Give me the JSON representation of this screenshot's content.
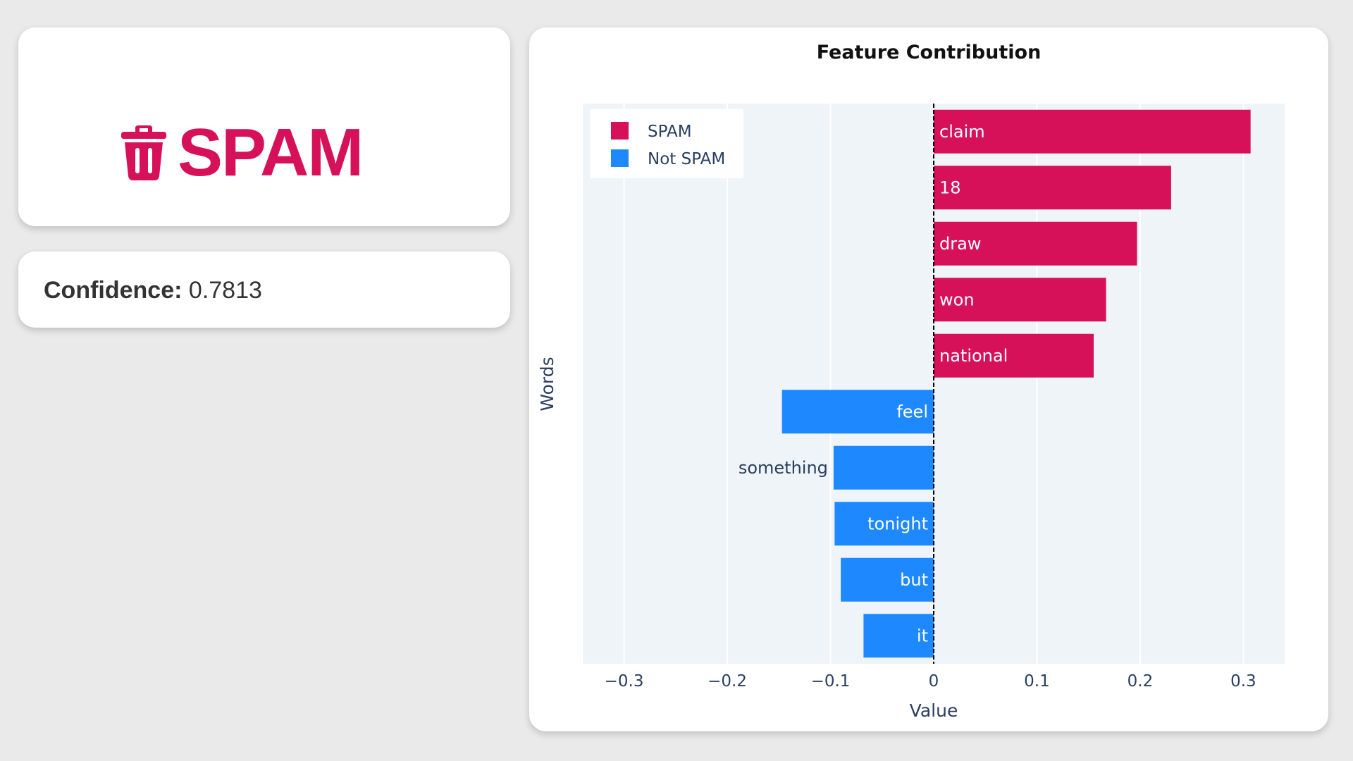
{
  "verdict": {
    "label": "SPAM",
    "icon": "trash-icon",
    "color": "#d6115a"
  },
  "confidence": {
    "label": "Confidence:",
    "value": "0.7813"
  },
  "chart_data": {
    "type": "bar",
    "orientation": "horizontal",
    "title": "Feature Contribution",
    "xlabel": "Value",
    "ylabel": "Words",
    "xlim": [
      -0.34,
      0.34
    ],
    "xticks": [
      -0.3,
      -0.2,
      -0.1,
      0,
      0.1,
      0.2,
      0.3
    ],
    "xtick_labels": [
      "−0.3",
      "−0.2",
      "−0.1",
      "0",
      "0.1",
      "0.2",
      "0.3"
    ],
    "grid": true,
    "legend_position": "top-left",
    "series": [
      {
        "name": "SPAM",
        "color": "#d6115a"
      },
      {
        "name": "Not SPAM",
        "color": "#1e88ff"
      }
    ],
    "bars": [
      {
        "word": "claim",
        "value": 0.307,
        "series": "SPAM",
        "label_position": "inside"
      },
      {
        "word": "18",
        "value": 0.23,
        "series": "SPAM",
        "label_position": "inside"
      },
      {
        "word": "draw",
        "value": 0.197,
        "series": "SPAM",
        "label_position": "inside"
      },
      {
        "word": "won",
        "value": 0.167,
        "series": "SPAM",
        "label_position": "inside"
      },
      {
        "word": "national",
        "value": 0.155,
        "series": "SPAM",
        "label_position": "inside"
      },
      {
        "word": "feel",
        "value": -0.147,
        "series": "Not SPAM",
        "label_position": "inside"
      },
      {
        "word": "something",
        "value": -0.097,
        "series": "Not SPAM",
        "label_position": "outside"
      },
      {
        "word": "tonight",
        "value": -0.096,
        "series": "Not SPAM",
        "label_position": "inside"
      },
      {
        "word": "but",
        "value": -0.09,
        "series": "Not SPAM",
        "label_position": "inside"
      },
      {
        "word": "it",
        "value": -0.068,
        "series": "Not SPAM",
        "label_position": "inside"
      }
    ]
  }
}
